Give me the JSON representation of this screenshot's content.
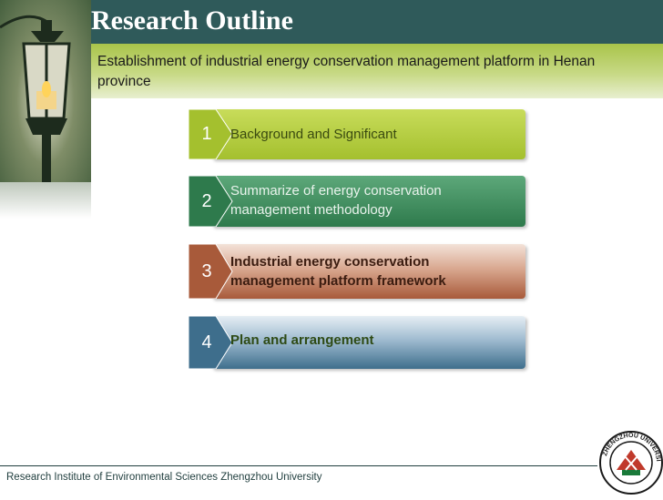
{
  "title": "Research Outline",
  "subtitle": "Establishment of industrial energy conservation management platform in Henan province",
  "items": [
    {
      "number": "1",
      "label": "Background and Significant"
    },
    {
      "number": "2",
      "label": "Summarize of energy conservation management methodology"
    },
    {
      "number": "3",
      "label": "Industrial energy conservation management platform framework"
    },
    {
      "number": "4",
      "label": "Plan and arrangement"
    }
  ],
  "footer": "Research Institute of Environmental Sciences Zhengzhou University",
  "colors": {
    "header": "#2f5a5a",
    "item1": "#a8c43a",
    "item2": "#3f8a5d",
    "item3": "#a85a3a",
    "item4": "#3e6e8c"
  },
  "icons": [
    "lamp-image",
    "zhengzhou-university-seal"
  ]
}
